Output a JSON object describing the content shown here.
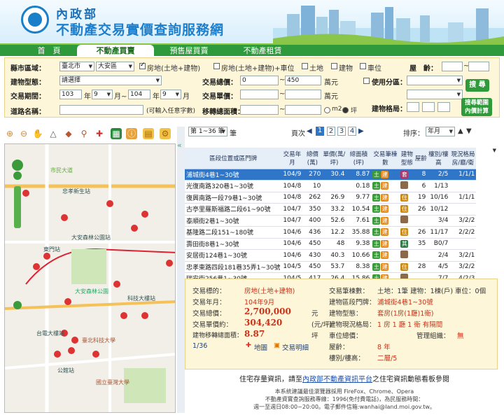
{
  "header": {
    "ministry": "內政部",
    "title": "不動產交易實價查詢服務網"
  },
  "nav": {
    "tabs": [
      "首　頁",
      "不動產買賣",
      "預售屋買賣",
      "不動產租賃"
    ]
  },
  "form": {
    "county_label": "縣市區域：",
    "county": "臺北市",
    "district": "大安區",
    "types": [
      "房地(土地+建物)",
      "房地(土地+建物)+車位",
      "土地",
      "建物",
      "車位"
    ],
    "age_label": "屋　齡：",
    "build_type_label": "建物型態：",
    "build_type": "請選擇",
    "total_price_label": "交易總價：",
    "total_price_from": "0",
    "total_price_to": "450",
    "total_unit": "萬元",
    "use_zone_label": "使用分區：",
    "period_label": "交易期間：",
    "year_from": "103",
    "m_from": "9",
    "year_to": "104",
    "m_to": "9",
    "y_word": "年",
    "m_word": "月~",
    "m_end": "月",
    "unit_price_label": "交易單價：",
    "unit_price_unit": "萬元",
    "road_label": "道路名稱：",
    "road_hint": "(可輸入任意字數)",
    "area_label": "移轉總面積：",
    "area_m2": "m2",
    "area_ping": "坪",
    "layout_label": "建物格局：",
    "search_btn": "搜 尋",
    "range_btn_1": "搜尋範圍",
    "range_btn_2": "內價計算"
  },
  "list": {
    "page_select": "第 1~36 筆",
    "page_label": "頁次",
    "pages": [
      "1",
      "2",
      "3",
      "4"
    ],
    "sort_label": "排序：",
    "sort_value": "年月",
    "headers": [
      "區段位置或區門牌",
      "交易年月",
      "總價(萬)",
      "單價(萬/坪)",
      "總面積(坪)",
      "交易筆棟數",
      "建物型態",
      "屋齡",
      "樓別/樓高",
      "現況格局 房/廳/衛"
    ],
    "rows": [
      [
        "浦城街4巷1~30號",
        "104/9",
        "270",
        "30.4",
        "8.87",
        "套",
        "8",
        "2/5",
        "1/1/1"
      ],
      [
        "光復南路320巷1~30號",
        "104/8",
        "10",
        "",
        "0.18",
        "",
        "6",
        "1/13",
        ""
      ],
      [
        "復興南路一段79巷1~30號",
        "104/8",
        "262",
        "26.9",
        "9.77",
        "住",
        "19",
        "10/16",
        "1/1/1"
      ],
      [
        "古亭里羅斯福路二段61~90號",
        "104/7",
        "350",
        "33.2",
        "10.54",
        "住",
        "26",
        "10/12",
        ""
      ],
      [
        "泰順街2巷1~30號",
        "104/7",
        "400",
        "52.6",
        "7.61",
        "",
        "",
        "3/4",
        "3/2/2"
      ],
      [
        "基隆路二段151~180號",
        "104/6",
        "436",
        "12.2",
        "35.88",
        "住",
        "26",
        "11/17",
        "2/2/2"
      ],
      [
        "壽田街8巷1~30號",
        "104/6",
        "450",
        "48",
        "9.38",
        "其",
        "35",
        "B0/7",
        ""
      ],
      [
        "安居街124巷1~30號",
        "104/6",
        "430",
        "40.3",
        "10.66",
        "",
        "",
        "2/4",
        "3/2/1"
      ],
      [
        "忠孝東路四段181巷35弄1~30號",
        "104/5",
        "450",
        "53.7",
        "8.38",
        "住",
        "28",
        "4/5",
        "3/2/2"
      ],
      [
        "瑞安街256巷1~30號",
        "104/5",
        "417",
        "26.4",
        "15.86",
        "",
        "",
        "7/7",
        "4/2/3"
      ]
    ]
  },
  "detail": {
    "target_l": "交易標的：",
    "target_v": "房地(土地+建物)",
    "ym_l": "交易年月：",
    "ym_v": "104年9月",
    "total_l": "交易總價：",
    "total_v": "2,700,000",
    "total_u": "元",
    "unit_l": "交易單價約：",
    "unit_v": "304,420",
    "unit_u": "(元/坪)",
    "area_l": "建物移轉總面積：",
    "area_v": "8.87",
    "area_u": "坪",
    "count_l": "交易筆棟數：",
    "count_v": "土地：1筆 建物：1棟(戶) 車位：0個",
    "addr_l": "建物區段門牌：",
    "addr_v": "浦城街4巷1~30號",
    "type_l": "建物型態：",
    "type_v": "套房(1房(1廳)1衛)",
    "layout_l": "建物現況格局：",
    "layout_v": "1 房 1 廳 1 衛 有隔間",
    "rent_l": "車位總價：",
    "mgmt_l": "管理組織：",
    "mgmt_v": "無",
    "age_l": "屋齡：",
    "age_v": "8 年",
    "floor_l": "樓別/樓高：",
    "floor_v": "二層/5",
    "page": "1/36",
    "map_link": "地圖",
    "detail_link": "交易明細"
  },
  "footer": {
    "line1_a": "住宅存量資訊，請至",
    "line1_link": "內政部不動產資訊平台",
    "line1_b": "之住宅資訊動態看板參閱",
    "line2": "本系統建議最佳瀏覽器採用 FireFox、Chrome、Opera",
    "line3": "不動產資實查詢服務專線：1996(免付費電話)，為民服務時間：",
    "line4": "週一至週日08:00~20:00。電子郵件信箱:wanhai@land.moi.gov.tw。"
  },
  "map": {
    "labels": [
      "市民大道",
      "民生",
      "忠孝新生站",
      "大安森林公園站",
      "東門站",
      "大安森林公園",
      "科技大樓站",
      "台電大樓站",
      "公館站",
      "臺北科技大學",
      "國立臺灣大學"
    ]
  }
}
